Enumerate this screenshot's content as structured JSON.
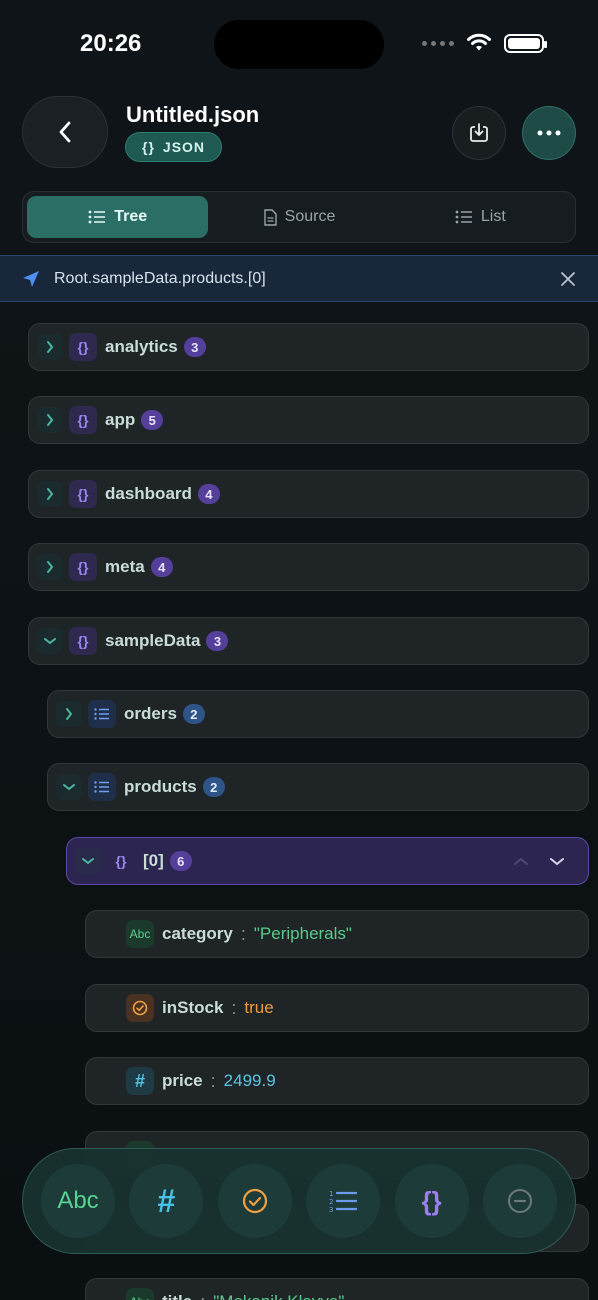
{
  "status": {
    "time": "20:26"
  },
  "header": {
    "title": "Untitled.json",
    "badge_icon": "{}",
    "badge_label": "JSON"
  },
  "tabs": [
    {
      "label": "Tree",
      "icon": "list-icon",
      "active": true
    },
    {
      "label": "Source",
      "icon": "document-icon",
      "active": false
    },
    {
      "label": "List",
      "icon": "list-icon",
      "active": false
    }
  ],
  "path": "Root.sampleData.products.[0]",
  "tree": [
    {
      "key": "analytics",
      "type": "object",
      "count": "3",
      "expanded": false,
      "depth": 0
    },
    {
      "key": "app",
      "type": "object",
      "count": "5",
      "expanded": false,
      "depth": 0
    },
    {
      "key": "dashboard",
      "type": "object",
      "count": "4",
      "expanded": false,
      "depth": 0
    },
    {
      "key": "meta",
      "type": "object",
      "count": "4",
      "expanded": false,
      "depth": 0
    },
    {
      "key": "sampleData",
      "type": "object",
      "count": "3",
      "expanded": true,
      "depth": 0
    },
    {
      "key": "orders",
      "type": "array",
      "count": "2",
      "expanded": false,
      "depth": 1
    },
    {
      "key": "products",
      "type": "array",
      "count": "2",
      "expanded": true,
      "depth": 1
    },
    {
      "key": "[0]",
      "type": "object",
      "count": "6",
      "expanded": true,
      "depth": 2,
      "selected": true
    },
    {
      "key": "category",
      "type": "string",
      "value": "\"Peripherals\"",
      "depth": 3
    },
    {
      "key": "inStock",
      "type": "boolean",
      "value": "true",
      "depth": 3
    },
    {
      "key": "price",
      "type": "number",
      "value": "2499.9",
      "depth": 3
    },
    {
      "key": "title",
      "type": "string",
      "value": "\"Mekanik Klavye\"",
      "depth": 3
    }
  ],
  "type_icons": {
    "string": "Abc",
    "number": "#",
    "object": "{}"
  },
  "colon": ":",
  "toolbar": [
    {
      "name": "add-string-button",
      "label": "Abc"
    },
    {
      "name": "add-number-button",
      "label": "#"
    },
    {
      "name": "add-boolean-button",
      "icon": "check-circle-icon"
    },
    {
      "name": "add-array-button",
      "icon": "numbered-list-icon"
    },
    {
      "name": "add-object-button",
      "label": "{}"
    },
    {
      "name": "add-null-button",
      "icon": "minus-circle-icon"
    }
  ],
  "colors": {
    "accent": "#2a6e65",
    "object": "#9d86ee",
    "array": "#6e9ff2",
    "string": "#59cc8c",
    "boolean": "#e89b3e",
    "number": "#5cc4e2"
  }
}
